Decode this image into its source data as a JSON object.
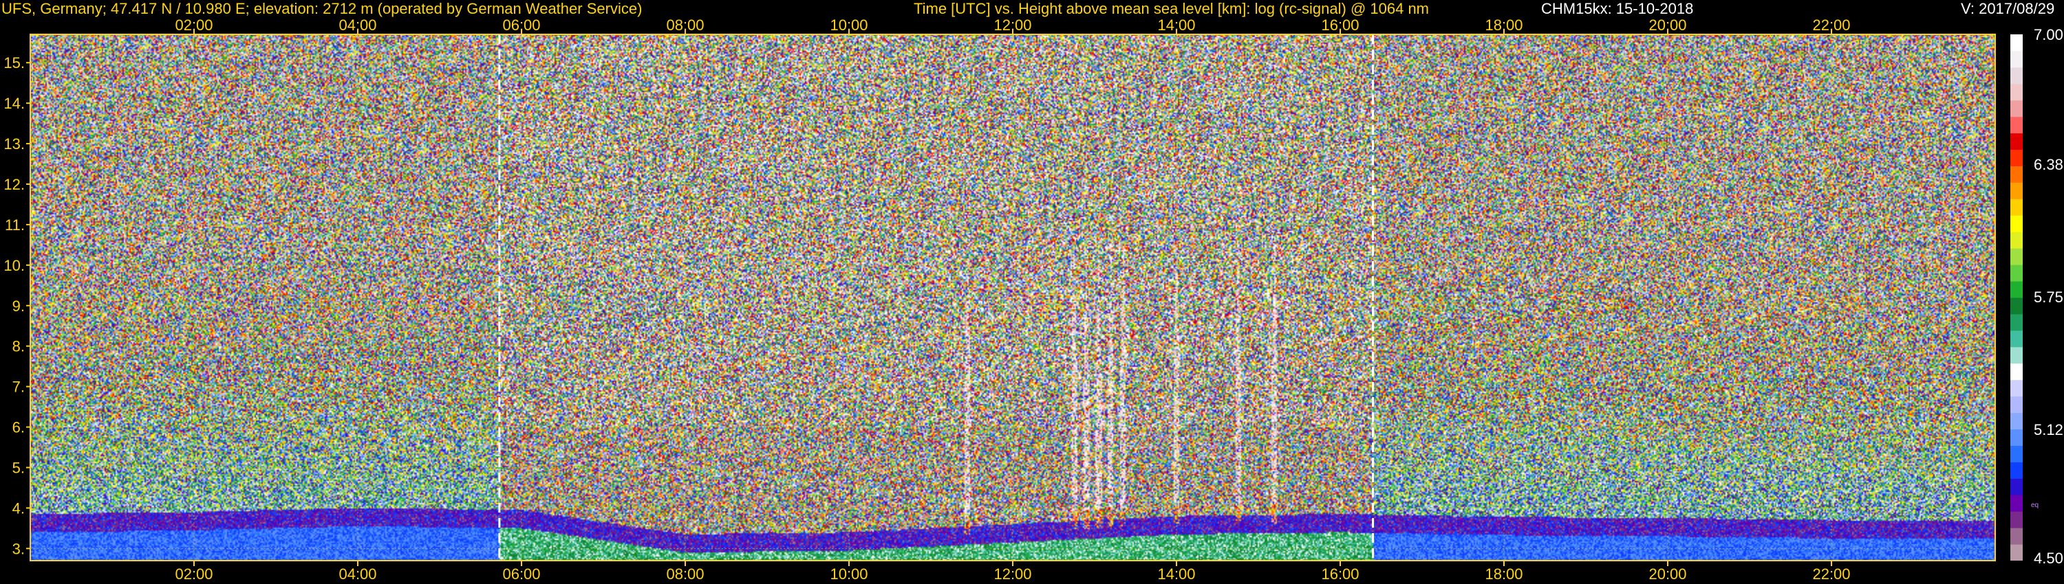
{
  "header": {
    "site": "UFS, Germany; 47.417 N / 10.980 E; elevation: 2712 m  (operated by German Weather Service)",
    "title": "Time [UTC] vs. Height above mean sea level [km]: log (rc-signal) @ 1064 nm",
    "instrument": "CHM15kx: 15-10-2018",
    "version": "V: 2017/08/29"
  },
  "chart_data": {
    "type": "heatmap",
    "title": "Time [UTC] vs. Height above mean sea level [km]: log (rc-signal) @ 1064 nm",
    "xlabel": "Time [UTC]",
    "ylabel": "Height above mean sea level [km]",
    "xlim": [
      0,
      24
    ],
    "ylim": [
      2.7,
      15.7
    ],
    "x_ticks": [
      "02:00",
      "04:00",
      "06:00",
      "08:00",
      "10:00",
      "12:00",
      "14:00",
      "16:00",
      "18:00",
      "20:00",
      "22:00"
    ],
    "x_tick_values": [
      2,
      4,
      6,
      8,
      10,
      12,
      14,
      16,
      18,
      20,
      22
    ],
    "y_ticks": [
      "3.",
      "4.",
      "5.",
      "6.",
      "7.",
      "8.",
      "9.",
      "10.",
      "11.",
      "12.",
      "13.",
      "14.",
      "15."
    ],
    "y_tick_values": [
      3,
      4,
      5,
      6,
      7,
      8,
      9,
      10,
      11,
      12,
      13,
      14,
      15
    ],
    "grid": true,
    "markers_hours": [
      5.73,
      16.4
    ],
    "colorbar": {
      "min": 4.5,
      "max": 7.0,
      "labels": [
        "7.00",
        "6.38",
        "5.75",
        "5.12",
        "4.50"
      ],
      "label_values": [
        7.0,
        6.38,
        5.75,
        5.12,
        4.5
      ],
      "unit_glyph": "eq",
      "colors": [
        "#b89aa8",
        "#9a6a90",
        "#7a2a8a",
        "#6a00b0",
        "#2a10d0",
        "#1040ff",
        "#2a70ff",
        "#5a90ff",
        "#8aaaff",
        "#b0b8ff",
        "#d0d0ff",
        "#ffffff",
        "#a0e0d0",
        "#40c0a0",
        "#20a060",
        "#108030",
        "#20b030",
        "#60d040",
        "#a0e040",
        "#e0f020",
        "#ffff00",
        "#ffd000",
        "#ffa000",
        "#ff7000",
        "#ff3000",
        "#e00000",
        "#ff6060",
        "#f0a0a0",
        "#f0c8c8",
        "#e8d8e0",
        "#f4f0f4",
        "#ffffff"
      ]
    },
    "boundary_layer_top_km": [
      [
        0,
        3.85
      ],
      [
        2,
        3.9
      ],
      [
        4,
        4.0
      ],
      [
        6,
        3.95
      ],
      [
        8,
        3.35
      ],
      [
        10,
        3.4
      ],
      [
        12,
        3.6
      ],
      [
        14,
        3.8
      ],
      [
        16,
        3.85
      ],
      [
        18,
        3.78
      ],
      [
        20,
        3.75
      ],
      [
        22,
        3.7
      ],
      [
        24,
        3.7
      ]
    ],
    "cloud_streaks_hours": [
      11.45,
      12.75,
      12.9,
      13.05,
      13.2,
      13.35,
      14.0,
      14.75,
      15.2
    ]
  }
}
